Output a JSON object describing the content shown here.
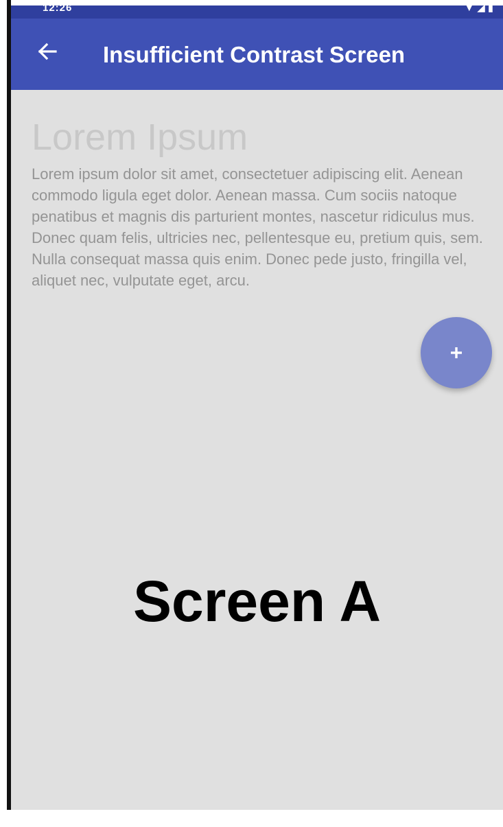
{
  "status_bar": {
    "time": "12:26",
    "icons": [
      "wifi-icon",
      "signal-icon",
      "battery-icon"
    ]
  },
  "app_bar": {
    "back_icon": "arrow-left-icon",
    "title": "Insufficient Contrast Screen",
    "background_color": "#3f51b5"
  },
  "content": {
    "heading": "Lorem Ipsum",
    "body": "Lorem ipsum dolor sit amet, consectetuer adipiscing elit. Aenean commodo ligula eget dolor. Aenean massa. Cum sociis natoque penatibus et magnis dis parturient montes, nascetur ridiculus mus. Donec quam felis, ultricies nec, pellentesque eu, pretium quis, sem. Nulla consequat massa quis enim. Donec pede justo, fringilla vel, aliquet nec, vulputate eget, arcu.",
    "heading_color": "#c8c8c8",
    "body_color": "#949494",
    "background_color": "#e0e0e0"
  },
  "fab": {
    "icon": "plus-icon",
    "color": "#7986cb"
  },
  "label": {
    "text": "Screen A"
  }
}
